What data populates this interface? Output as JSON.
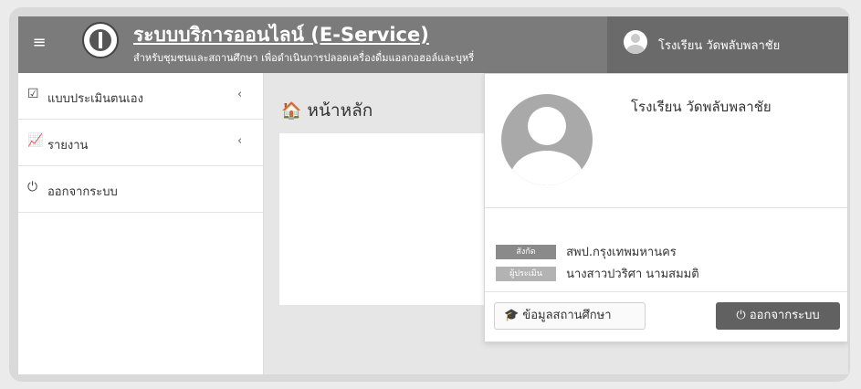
{
  "header": {
    "menu_icon": "hamburger-icon",
    "title": "ระบบบริการออนไลน์ (E-Service)",
    "subtitle": "สำหรับชุมชนและสถานศึกษา เพื่อดำเนินการปลอดเครื่องดื่มแอลกอฮอล์และบุหรี่",
    "user_name": "โรงเรียน วัดพลับพลาชัย"
  },
  "sidebar": {
    "items": [
      {
        "icon": "☑",
        "label": "แบบประเมินตนเอง",
        "chevron": "‹"
      },
      {
        "icon": "📈",
        "label": "รายงาน",
        "chevron": "‹"
      },
      {
        "icon": "⏻",
        "label": "ออกจากระบบ"
      }
    ]
  },
  "main": {
    "home_icon": "🏠",
    "title": "หน้าหลัก"
  },
  "profile": {
    "name": "โรงเรียน วัดพลับพลาชัย",
    "affiliation_label": "สังกัด",
    "affiliation_value": "สพป.กรุงเทพมหานคร",
    "assessor_label": "ผู้ประเมิน",
    "assessor_value": "นางสาวปวริศา นามสมมติ",
    "school_info_icon": "🎓",
    "school_info_button": "ข้อมูลสถานศึกษา",
    "logout_icon": "⏻",
    "logout_button": "ออกจากระบบ"
  },
  "colors": {
    "header_bg": "#7b7b7b",
    "user_area_bg": "#6a6a6a",
    "logout_bg": "#616161"
  }
}
